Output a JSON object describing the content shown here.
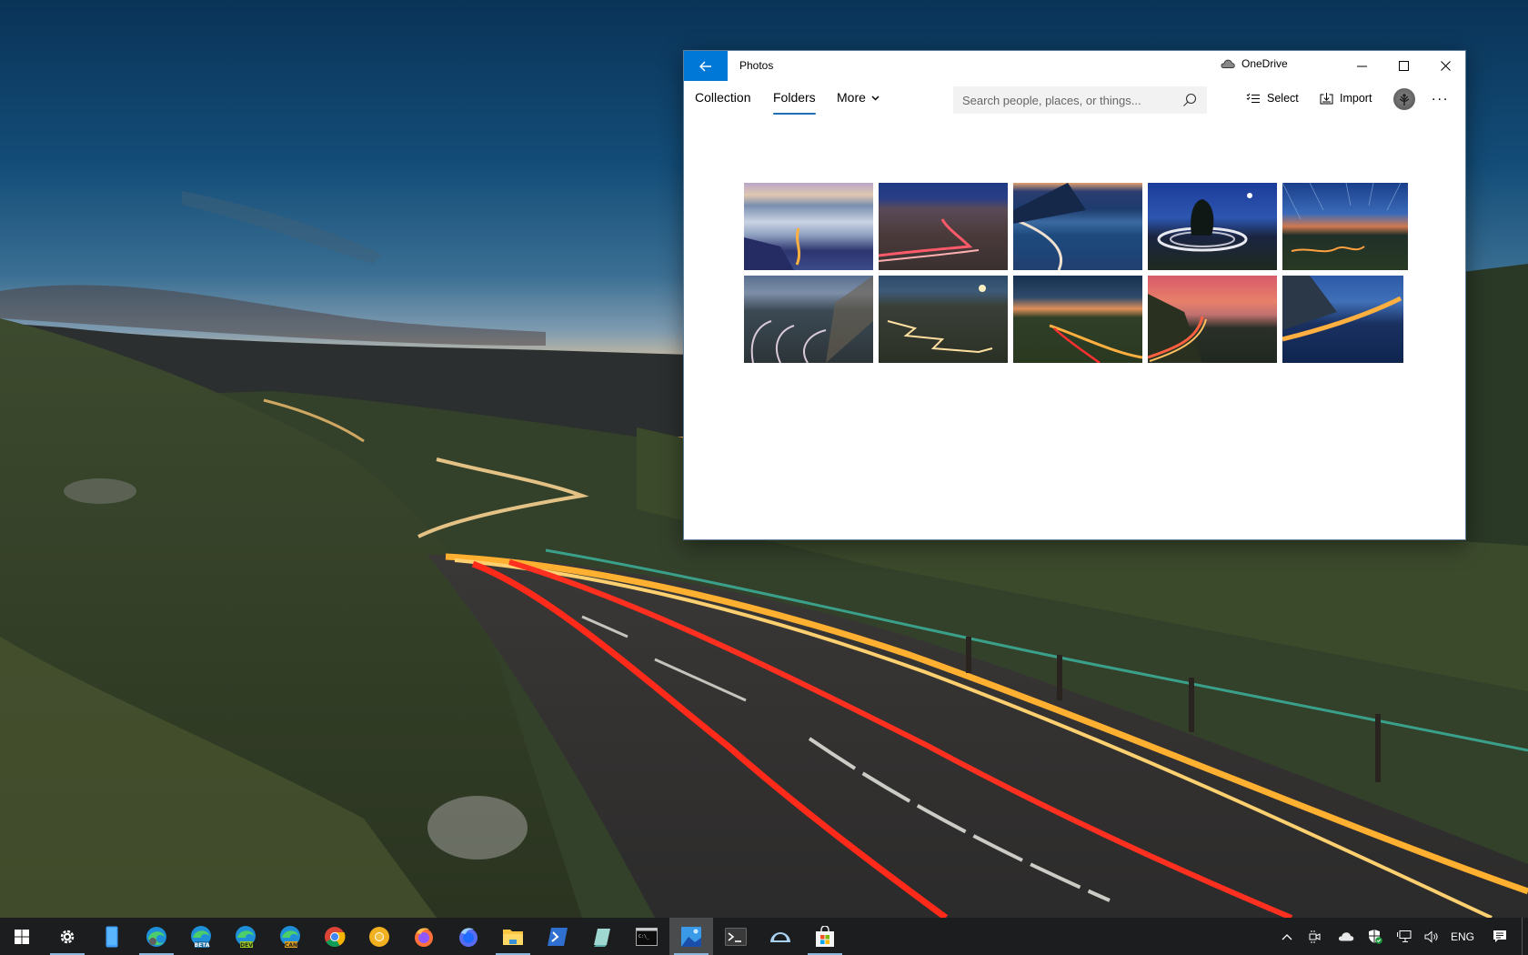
{
  "window": {
    "app_title": "Photos",
    "back_icon": "arrow-left-icon",
    "onedrive_label": "OneDrive",
    "onedrive_icon": "cloud-icon",
    "caption_buttons": [
      "minimize",
      "maximize",
      "close"
    ]
  },
  "nav": {
    "tabs": [
      {
        "label": "Collection",
        "active": false
      },
      {
        "label": "Folders",
        "active": true
      },
      {
        "label": "More",
        "active": false,
        "has_dropdown": true
      }
    ],
    "accent_color": "#1f6fb5"
  },
  "search": {
    "placeholder": "Search people, places, or things...",
    "value": ""
  },
  "commands": {
    "select_label": "Select",
    "import_label": "Import",
    "more_label": "..."
  },
  "thumbnails": [
    {
      "description": "Snowy mountain valley with winding light trail at dusk",
      "row": 1
    },
    {
      "description": "Red light trail on mountain road at night",
      "row": 1
    },
    {
      "description": "Blue coastal highway with light trails",
      "row": 1
    },
    {
      "description": "Roundabout light trail under moon",
      "row": 1
    },
    {
      "description": "Star trails over hill with glowing road",
      "row": 1
    },
    {
      "description": "Zigzag mountain road light trails",
      "row": 2
    },
    {
      "description": "Switchback road up rocky mountain with moon",
      "row": 2
    },
    {
      "description": "Highway light trails at sunset",
      "row": 2
    },
    {
      "description": "Coastal road at pink sunset",
      "row": 2
    },
    {
      "description": "Bridge over blue lake with light trail",
      "row": 2
    }
  ],
  "taskbar": {
    "items": [
      {
        "name": "start",
        "icon": "windows-logo-icon",
        "running": false
      },
      {
        "name": "settings",
        "icon": "gear-icon",
        "running": true
      },
      {
        "name": "phone",
        "icon": "phone-icon",
        "running": false
      },
      {
        "name": "edge",
        "icon": "edge-icon",
        "running": true
      },
      {
        "name": "edge-beta",
        "icon": "edge-beta-icon",
        "badge": "BETA",
        "running": false
      },
      {
        "name": "edge-dev",
        "icon": "edge-dev-icon",
        "badge": "DEV",
        "running": false
      },
      {
        "name": "edge-canary",
        "icon": "edge-canary-icon",
        "badge": "CAN",
        "running": false
      },
      {
        "name": "chrome",
        "icon": "chrome-icon",
        "running": false
      },
      {
        "name": "chrome-canary",
        "icon": "chrome-canary-icon",
        "running": false
      },
      {
        "name": "firefox",
        "icon": "firefox-icon",
        "running": false
      },
      {
        "name": "firefox-developer",
        "icon": "firefox-dev-icon",
        "running": false
      },
      {
        "name": "file-explorer",
        "icon": "folder-icon",
        "running": true
      },
      {
        "name": "powershell",
        "icon": "powershell-icon",
        "running": false
      },
      {
        "name": "notepad",
        "icon": "notepad-icon",
        "running": false
      },
      {
        "name": "command-prompt",
        "icon": "cmd-icon",
        "running": false
      },
      {
        "name": "photos",
        "icon": "photos-icon",
        "running": true,
        "active": true
      },
      {
        "name": "terminal",
        "icon": "terminal-icon",
        "running": false
      },
      {
        "name": "protractor-app",
        "icon": "protractor-icon",
        "running": false
      },
      {
        "name": "store",
        "icon": "store-icon",
        "running": true
      }
    ],
    "tray": {
      "overflow_icon": "chevron-up-icon",
      "meet_now_icon": "meet-now-icon",
      "onedrive_icon": "cloud-icon",
      "security_icon": "shield-icon",
      "network_icon": "network-icon",
      "volume_icon": "volume-icon",
      "language": "ENG",
      "notifications_icon": "notification-icon"
    }
  }
}
